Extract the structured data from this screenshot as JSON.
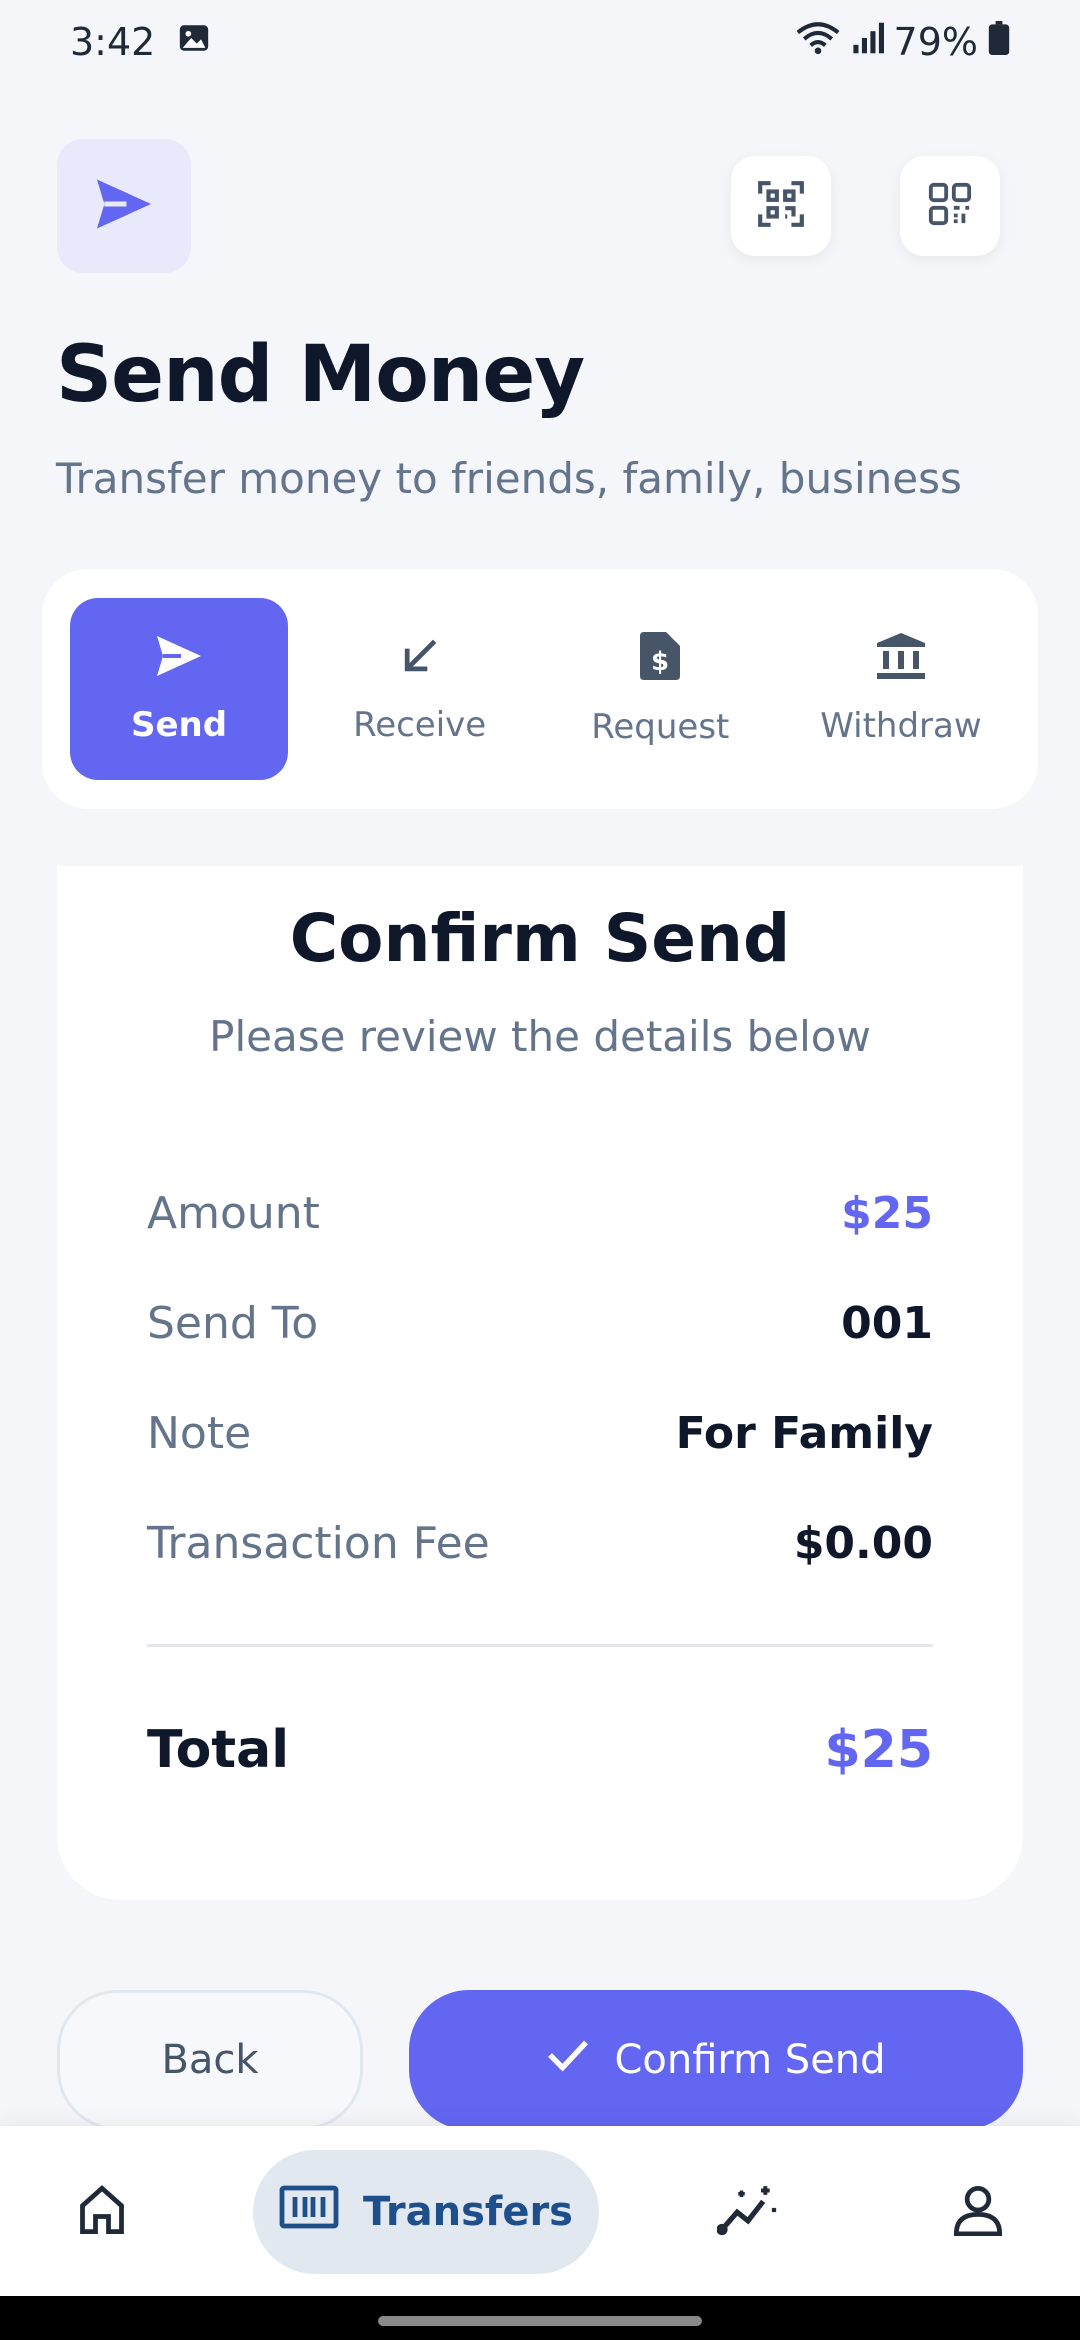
{
  "status_bar": {
    "time": "3:42",
    "battery": "79%"
  },
  "header": {
    "title": "Send Money",
    "subtitle": "Transfer money to friends, family, business",
    "icons": {
      "main": "send-icon",
      "scan": "qr-scan-icon",
      "code": "qr-code-icon"
    }
  },
  "action_tabs": [
    {
      "label": "Send",
      "icon": "send-icon",
      "active": true
    },
    {
      "label": "Receive",
      "icon": "receive-arrow-icon",
      "active": false
    },
    {
      "label": "Request",
      "icon": "invoice-icon",
      "active": false
    },
    {
      "label": "Withdraw",
      "icon": "bank-icon",
      "active": false
    }
  ],
  "confirm_card": {
    "title": "Confirm Send",
    "subtitle": "Please review the details below",
    "rows": [
      {
        "label": "Amount",
        "value": "$25"
      },
      {
        "label": "Send To",
        "value": "001"
      },
      {
        "label": "Note",
        "value": "For Family"
      },
      {
        "label": "Transaction Fee",
        "value": "$0.00"
      }
    ],
    "total_label": "Total",
    "total_value": "$25"
  },
  "buttons": {
    "back": "Back",
    "confirm": "Confirm Send"
  },
  "bottom_nav": {
    "items": [
      {
        "icon": "home-icon",
        "label": ""
      },
      {
        "icon": "transfers-icon",
        "label": "Transfers",
        "active": true
      },
      {
        "icon": "analytics-icon",
        "label": ""
      },
      {
        "icon": "profile-icon",
        "label": ""
      }
    ]
  },
  "colors": {
    "accent": "#6366f1",
    "accent_light": "#e8e9fb",
    "text_primary": "#0f172a",
    "text_secondary": "#64748b",
    "nav_active_bg": "#e2e8f0",
    "nav_active_text": "#1e4f8a"
  }
}
